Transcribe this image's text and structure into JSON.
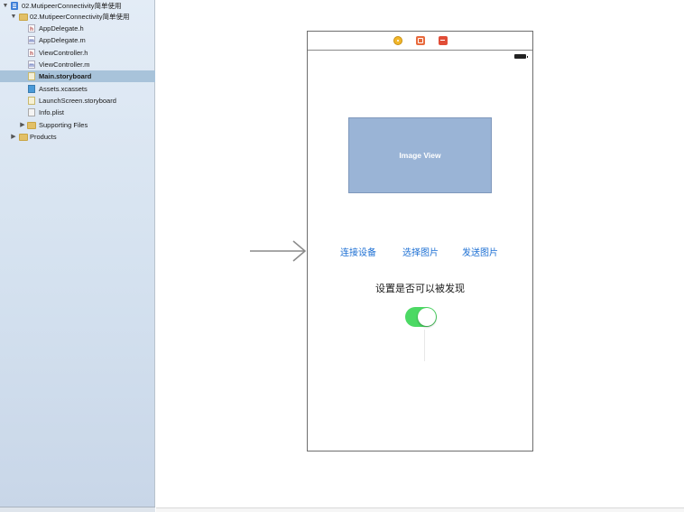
{
  "navigator": {
    "items": [
      {
        "label": "02.MutipeerConnectivity简单使用",
        "icon": "project-icon",
        "level": 0,
        "expanded": true
      },
      {
        "label": "02.MutipeerConnectivity简单使用",
        "icon": "folder-icon",
        "level": 1,
        "expanded": true
      },
      {
        "label": "AppDelegate.h",
        "icon": "header-file-icon",
        "glyph": "h",
        "level": 2
      },
      {
        "label": "AppDelegate.m",
        "icon": "implementation-file-icon",
        "glyph": "m",
        "level": 2
      },
      {
        "label": "ViewController.h",
        "icon": "header-file-icon",
        "glyph": "h",
        "level": 2
      },
      {
        "label": "ViewController.m",
        "icon": "implementation-file-icon",
        "glyph": "m",
        "level": 2
      },
      {
        "label": "Main.storyboard",
        "icon": "storyboard-file-icon",
        "level": 2,
        "selected": true
      },
      {
        "label": "Assets.xcassets",
        "icon": "asset-catalog-icon",
        "level": 2
      },
      {
        "label": "LaunchScreen.storyboard",
        "icon": "storyboard-file-icon",
        "level": 2
      },
      {
        "label": "Info.plist",
        "icon": "plist-file-icon",
        "level": 2
      },
      {
        "label": "Supporting Files",
        "icon": "folder-icon",
        "level": 2,
        "expanded": false
      },
      {
        "label": "Products",
        "icon": "folder-icon",
        "level": 1,
        "expanded": false
      }
    ]
  },
  "scene": {
    "image_view_label": "Image View",
    "buttons": {
      "connect": "连接设备",
      "choose_image": "选择图片",
      "send_image": "发送图片"
    },
    "discoverable_label": "设置是否可以被发现",
    "discoverable_switch_on": true
  },
  "colors": {
    "selection": "#a8c3da",
    "button_tint": "#1c6fd3",
    "switch_on": "#4cd964",
    "image_view_bg": "#9ab4d6"
  }
}
